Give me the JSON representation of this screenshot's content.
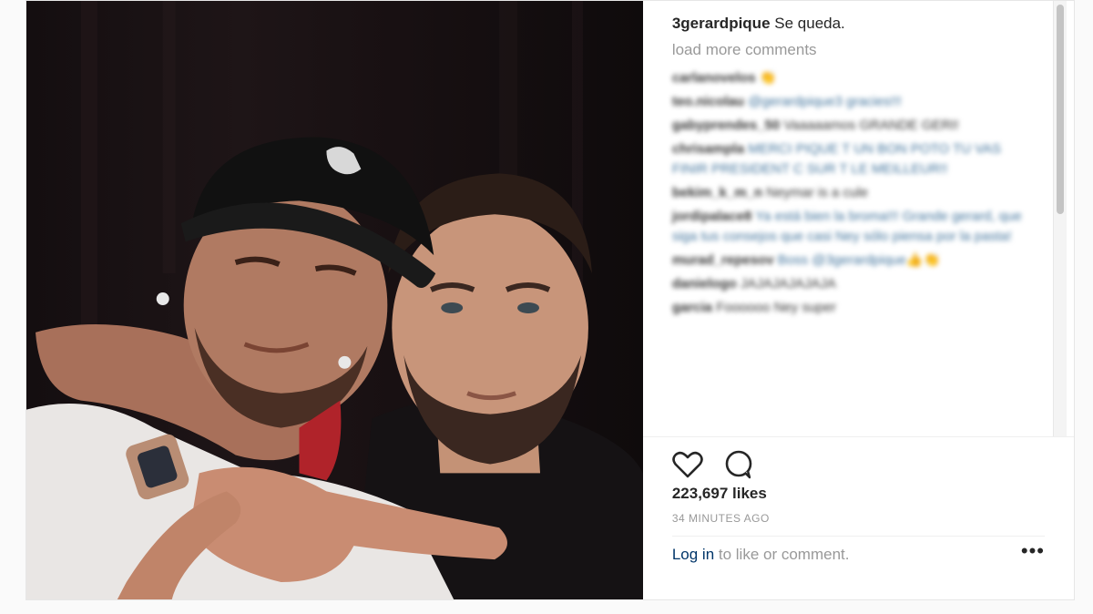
{
  "post": {
    "caption_user": "3gerardpique",
    "caption_text": "Se queda.",
    "load_more": "load more comments",
    "comments": [
      {
        "user": "carlanovelos",
        "text": "👏"
      },
      {
        "user": "teo.nicolau",
        "text": "@gerardpique3 gracies!!!"
      },
      {
        "user": "gabyprendes_50",
        "text": "Vaaaaamos GRANDE GERI!"
      },
      {
        "user": "chrisampla",
        "text": "MERCI PIQUE T UN BON POTO TU VAS FINIR PRESIDENT C SUR T LE MEILLEUR!!"
      },
      {
        "user": "bekim_k_m_n",
        "text": "Neymar is a cule"
      },
      {
        "user": "jordipalace8",
        "text": "Ya está bien la broma!!! Grande gerard, que siga tus consejos que casi Ney sólo piensa por la pasta!"
      },
      {
        "user": "murad_repesov",
        "text": "Boss @3gerardpique👍👏"
      },
      {
        "user": "danielogo",
        "text": "JAJAJAJAJAJA"
      },
      {
        "user": "garcia",
        "text": "Foooooo Ney super"
      }
    ],
    "likes": "223,697 likes",
    "time_ago": "34 MINUTES AGO",
    "login_link": "Log in",
    "login_rest": " to like or comment.",
    "more_options": "•••",
    "icons": {
      "like": "heart-icon",
      "comment": "comment-bubble-icon"
    }
  }
}
